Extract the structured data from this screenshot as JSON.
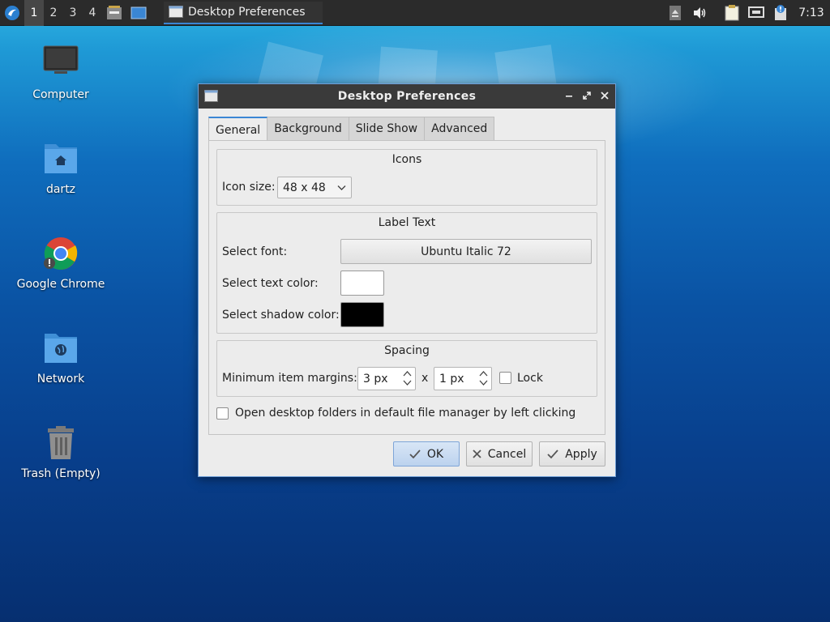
{
  "taskbar": {
    "workspaces": [
      "1",
      "2",
      "3",
      "4"
    ],
    "active_workspace": "1",
    "task_label": "Desktop Preferences",
    "clock": "7:13",
    "accent": "#3a86d4"
  },
  "desktop": {
    "icons": [
      {
        "label": "Computer",
        "icon": "monitor-icon"
      },
      {
        "label": "dartz",
        "icon": "home-folder-icon"
      },
      {
        "label": "Google Chrome",
        "icon": "chrome-icon"
      },
      {
        "label": "Network",
        "icon": "network-folder-icon"
      },
      {
        "label": "Trash (Empty)",
        "icon": "trash-icon"
      }
    ]
  },
  "dialog": {
    "title": "Desktop Preferences",
    "tabs": [
      "General",
      "Background",
      "Slide Show",
      "Advanced"
    ],
    "active_tab": "General",
    "icons_group": {
      "title": "Icons",
      "icon_size_label": "Icon size:",
      "icon_size_value": "48 x 48"
    },
    "label_text_group": {
      "title": "Label Text",
      "font_label": "Select font:",
      "font_value": "Ubuntu Italic 72",
      "text_color_label": "Select text color:",
      "text_color": "#ffffff",
      "shadow_color_label": "Select shadow color:",
      "shadow_color": "#000000"
    },
    "spacing_group": {
      "title": "Spacing",
      "margins_label": "Minimum item margins:",
      "margin_x": "3 px",
      "separator": "x",
      "margin_y": "1 px",
      "lock_label": "Lock",
      "lock_checked": false
    },
    "open_folders_label": "Open desktop folders in default file manager by left clicking",
    "open_folders_checked": false,
    "buttons": {
      "ok": "OK",
      "cancel": "Cancel",
      "apply": "Apply"
    }
  }
}
